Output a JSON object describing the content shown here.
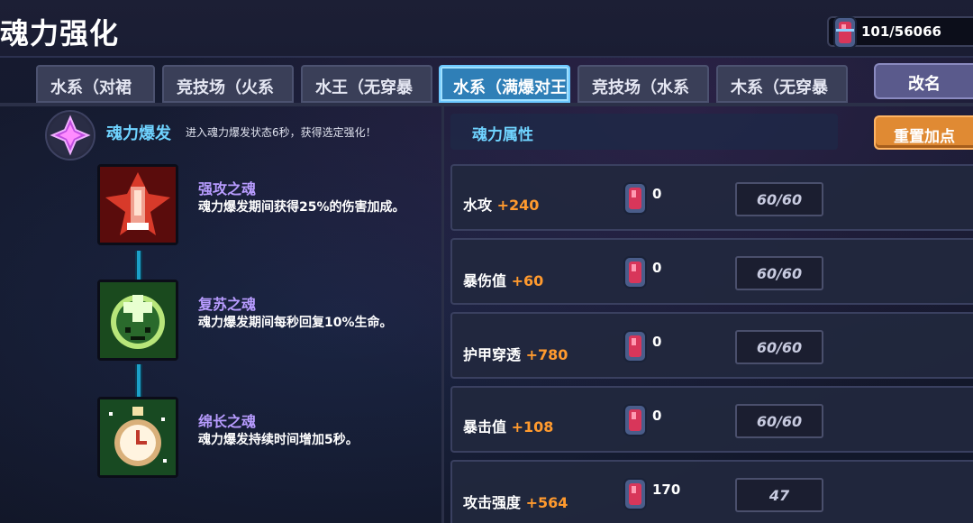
{
  "title": "魂力强化",
  "currency": {
    "icon": "soul-gem-icon",
    "value": "101/56066"
  },
  "tabs": [
    {
      "label": "水系（对裙",
      "active": false
    },
    {
      "label": "竞技场（火系",
      "active": false
    },
    {
      "label": "水王（无穿暴",
      "active": false
    },
    {
      "label": "水系（满爆对王",
      "active": true
    },
    {
      "label": "竞技场（水系",
      "active": false
    },
    {
      "label": "木系（无穿暴",
      "active": false
    }
  ],
  "rename_label": "改名",
  "skill": {
    "name": "魂力爆发",
    "description": "进入魂力爆发状态6秒，获得选定强化！"
  },
  "souls": [
    {
      "name": "强攻之魂",
      "description": "魂力爆发期间获得25%的伤害加成。"
    },
    {
      "name": "复苏之魂",
      "description": "魂力爆发期间每秒回复10%生命。"
    },
    {
      "name": "绵长之魂",
      "description": "魂力爆发持续时间增加5秒。"
    }
  ],
  "attributes_title": "魂力属性",
  "reset_label": "重置加点",
  "attributes": [
    {
      "name": "水攻",
      "bonus": "+240",
      "count": "0",
      "progress": "60/60"
    },
    {
      "name": "暴伤值",
      "bonus": "+60",
      "count": "0",
      "progress": "60/60"
    },
    {
      "name": "护甲穿透",
      "bonus": "+780",
      "count": "0",
      "progress": "60/60"
    },
    {
      "name": "暴击值",
      "bonus": "+108",
      "count": "0",
      "progress": "60/60"
    },
    {
      "name": "攻击强度",
      "bonus": "+564",
      "count": "170",
      "progress": "47"
    }
  ],
  "colors": {
    "accent_cyan": "#6fd3ff",
    "bonus_orange": "#ff9a2e",
    "soul_name_purple": "#b89cff",
    "active_tab": "#2f7fb7",
    "reset_button": "#e08a33"
  }
}
